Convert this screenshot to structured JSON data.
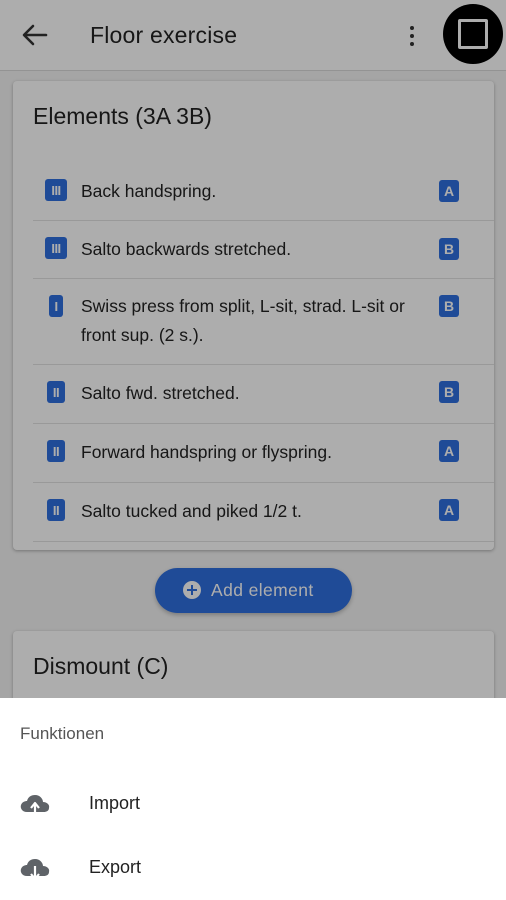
{
  "appbar": {
    "title": "Floor exercise",
    "back_icon": "arrow-left-icon",
    "more_icon": "more-vertical-icon",
    "select_icon": "checkbox-outline-icon"
  },
  "elements_card": {
    "title": "Elements (3A 3B)",
    "items": [
      {
        "level": "III",
        "name": "Back handspring.",
        "difficulty": "A"
      },
      {
        "level": "III",
        "name": "Salto backwards stretched.",
        "difficulty": "B"
      },
      {
        "level": "I",
        "name": "Swiss press from split, L-sit, strad. L-sit or front sup. (2 s.).",
        "difficulty": "B"
      },
      {
        "level": "II",
        "name": "Salto fwd. stretched.",
        "difficulty": "B"
      },
      {
        "level": "II",
        "name": "Forward handspring or flyspring.",
        "difficulty": "A"
      },
      {
        "level": "II",
        "name": "Salto tucked and piked 1/2 t.",
        "difficulty": "A"
      }
    ]
  },
  "add_button": {
    "label": "Add element",
    "icon": "plus-circle-icon"
  },
  "dismount_card": {
    "title": "Dismount (C)"
  },
  "sheet": {
    "heading": "Funktionen",
    "items": [
      {
        "label": "Import",
        "icon": "cloud-upload-icon"
      },
      {
        "label": "Export",
        "icon": "cloud-download-icon"
      }
    ]
  },
  "colors": {
    "accent": "#2f6fdf",
    "scrim": "rgba(0,0,0,0.32)"
  }
}
